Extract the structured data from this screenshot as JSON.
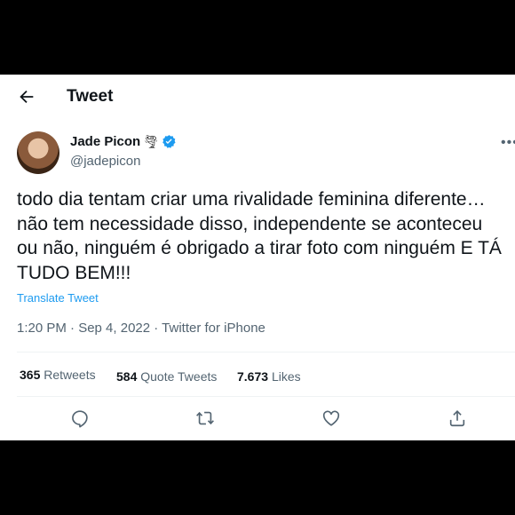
{
  "header": {
    "title": "Tweet"
  },
  "author": {
    "name": "Jade Picon",
    "emoji": "🌪",
    "handle": "@jadepicon"
  },
  "tweet": {
    "text": "todo dia tentam criar uma rivalidade feminina diferente… não tem necessidade disso, independente se aconteceu ou não, ninguém é obrigado a tirar foto com ninguém E TÁ TUDO BEM!!!",
    "translate_label": "Translate Tweet",
    "meta": "1:20 PM · Sep 4, 2022 · Twitter for iPhone"
  },
  "stats": {
    "retweets_count": "365",
    "retweets_label": "Retweets",
    "quotes_count": "584",
    "quotes_label": "Quote Tweets",
    "likes_count": "7.673",
    "likes_label": "Likes"
  },
  "colors": {
    "accent": "#1d9bf0",
    "text": "#0f1419",
    "muted": "#536471"
  }
}
